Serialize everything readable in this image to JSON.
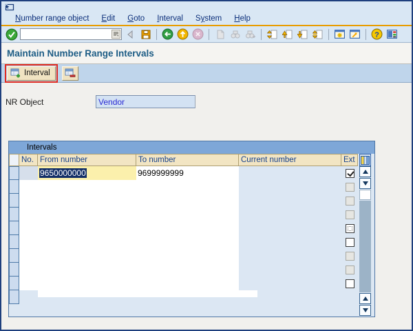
{
  "titlebar": {
    "icon": "screen-exit-icon"
  },
  "menu": {
    "items": [
      {
        "label": "Number range object",
        "underline": 0
      },
      {
        "label": "Edit",
        "underline": 0
      },
      {
        "label": "Goto",
        "underline": 0
      },
      {
        "label": "Interval",
        "underline": 0
      },
      {
        "label": "System",
        "underline": 1
      },
      {
        "label": "Help",
        "underline": 0
      }
    ]
  },
  "toolbar": {
    "command_value": "",
    "icon_names": [
      "enter-icon",
      "command-field",
      "back-step-icon",
      "save-icon",
      "back-icon",
      "exit-icon",
      "cancel-icon",
      "print-icon",
      "find-icon",
      "find-next-icon",
      "first-page-icon",
      "page-up-icon",
      "page-down-icon",
      "last-page-icon",
      "new-session-icon",
      "create-shortcut-icon",
      "help-icon",
      "customize-layout-icon"
    ]
  },
  "header": {
    "title": "Maintain Number Range Intervals"
  },
  "app_toolbar": {
    "interval_button_label": "Interval",
    "interval_button_annotated": true,
    "delete_button_icon": "delete-interval-icon"
  },
  "form": {
    "nr_object_label": "NR Object",
    "nr_object_value": "Vendor"
  },
  "intervals": {
    "title": "Intervals",
    "columns": [
      "No.",
      "From number",
      "To number",
      "Current number",
      "Ext"
    ],
    "selector_rows": 10,
    "rows": [
      {
        "no": "",
        "from": "9650000000",
        "to": "9699999999",
        "current": "",
        "ext_state": "checked",
        "row_selected": true,
        "from_text_selected": true
      },
      {
        "no": "",
        "from": "",
        "to": "",
        "current": "",
        "ext_state": "disabled"
      },
      {
        "no": "",
        "from": "",
        "to": "",
        "current": "",
        "ext_state": "disabled"
      },
      {
        "no": "",
        "from": "",
        "to": "",
        "current": "",
        "ext_state": "disabled"
      },
      {
        "no": "",
        "from": "",
        "to": "",
        "current": "",
        "ext_state": "focus"
      },
      {
        "no": "",
        "from": "",
        "to": "",
        "current": "",
        "ext_state": "enabled"
      },
      {
        "no": "",
        "from": "",
        "to": "",
        "current": "",
        "ext_state": "disabled"
      },
      {
        "no": "",
        "from": "",
        "to": "",
        "current": "",
        "ext_state": "disabled"
      },
      {
        "no": "",
        "from": "",
        "to": "",
        "current": "",
        "ext_state": "enabled"
      }
    ]
  },
  "colors": {
    "annotation_red": "#e02b20",
    "header_cell_bg": "#f2e5c3",
    "selection_bg": "#132f67",
    "selected_cell_yellow": "#fbf0ac",
    "field_bg": "#d3e2f3",
    "group_header_bg": "#7ea7d8",
    "menu_rule_orange": "#e89c00"
  }
}
